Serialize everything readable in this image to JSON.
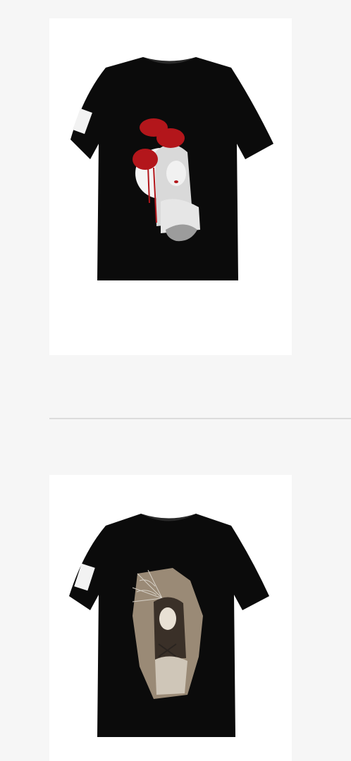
{
  "products": [
    {
      "name": "tshirt-poppy-portrait-print",
      "colors": {
        "shirt": "#0a0a0a",
        "accent": "#b3161b"
      }
    },
    {
      "name": "tshirt-spiderweb-portrait-print",
      "colors": {
        "shirt": "#0a0a0a",
        "accent": "#9a8a76"
      }
    }
  ]
}
